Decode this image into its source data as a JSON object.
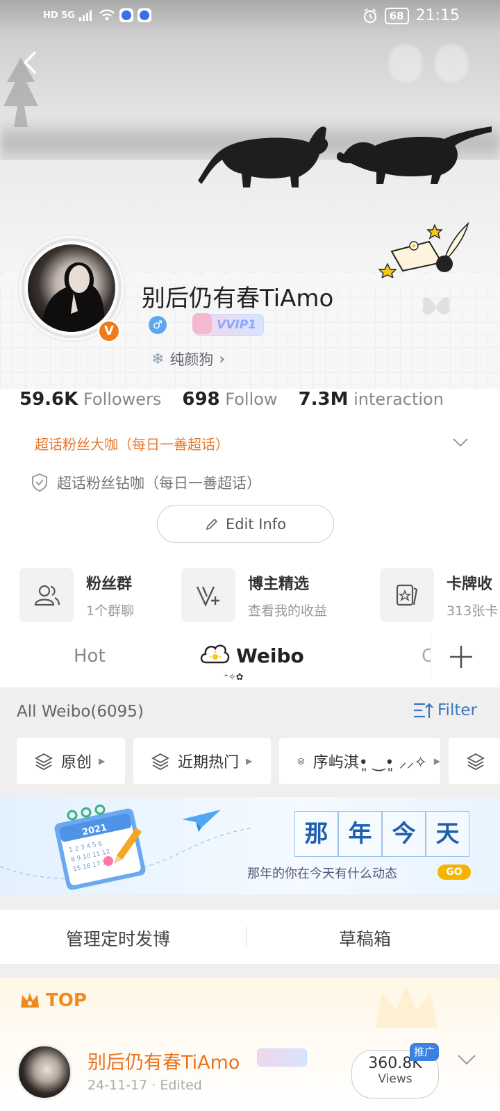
{
  "status_bar": {
    "left": "HD 5G",
    "battery": "68",
    "time": "21:15"
  },
  "profile": {
    "name": "别后仍有春TiAmo",
    "gender_symbol": "♂",
    "vip_badge": "VVIP1",
    "verified_badge": "V",
    "tagline": "纯颜狗",
    "tagline_arrow": "›"
  },
  "stats": [
    {
      "value": "59.6K",
      "label": "Followers"
    },
    {
      "value": "698",
      "label": "Follow"
    },
    {
      "value": "7.3M",
      "label": "interaction"
    }
  ],
  "super_topic_badges": [
    "超话粉丝大咖（每日一善超话）",
    "超话粉丝钻咖（每日一善超话）"
  ],
  "edit_button": "Edit Info",
  "features": [
    {
      "title": "粉丝群",
      "subtitle": "1个群聊",
      "icon": "people-icon"
    },
    {
      "title": "博主精选",
      "subtitle": "查看我的收益",
      "icon": "v-plus-icon"
    },
    {
      "title": "卡牌收",
      "subtitle": "313张卡",
      "icon": "card-icon"
    }
  ],
  "tabs": {
    "hot": "Hot",
    "weibo": "Weibo",
    "partial": "C",
    "weibo_decoration": "⁺✧✿"
  },
  "feed_header": {
    "all_weibo": "All Weibo(6095)",
    "filter": "Filter"
  },
  "chips": [
    {
      "label": "原创"
    },
    {
      "label": "近期热门"
    },
    {
      "label": "序屿淇•͈ ‿•͈ ⸝⸝✧"
    }
  ],
  "promo": {
    "title_chars": [
      "那",
      "年",
      "今",
      "天"
    ],
    "subtitle": "那年的你在今天有什么动态",
    "go": "GO",
    "calendar_year": "2021"
  },
  "schedule": {
    "scheduled_posts": "管理定时发博",
    "drafts": "草稿箱"
  },
  "top_post": {
    "top_label": "TOP",
    "author": "别后仍有春TiAmo",
    "date": "24-11-17 · Edited",
    "views_count": "360.8K",
    "views_label": "Views",
    "promo_tag": "推广"
  },
  "colors": {
    "accent_orange": "#e9731f",
    "link_blue": "#3b74c0",
    "gold": "#f5b400"
  }
}
